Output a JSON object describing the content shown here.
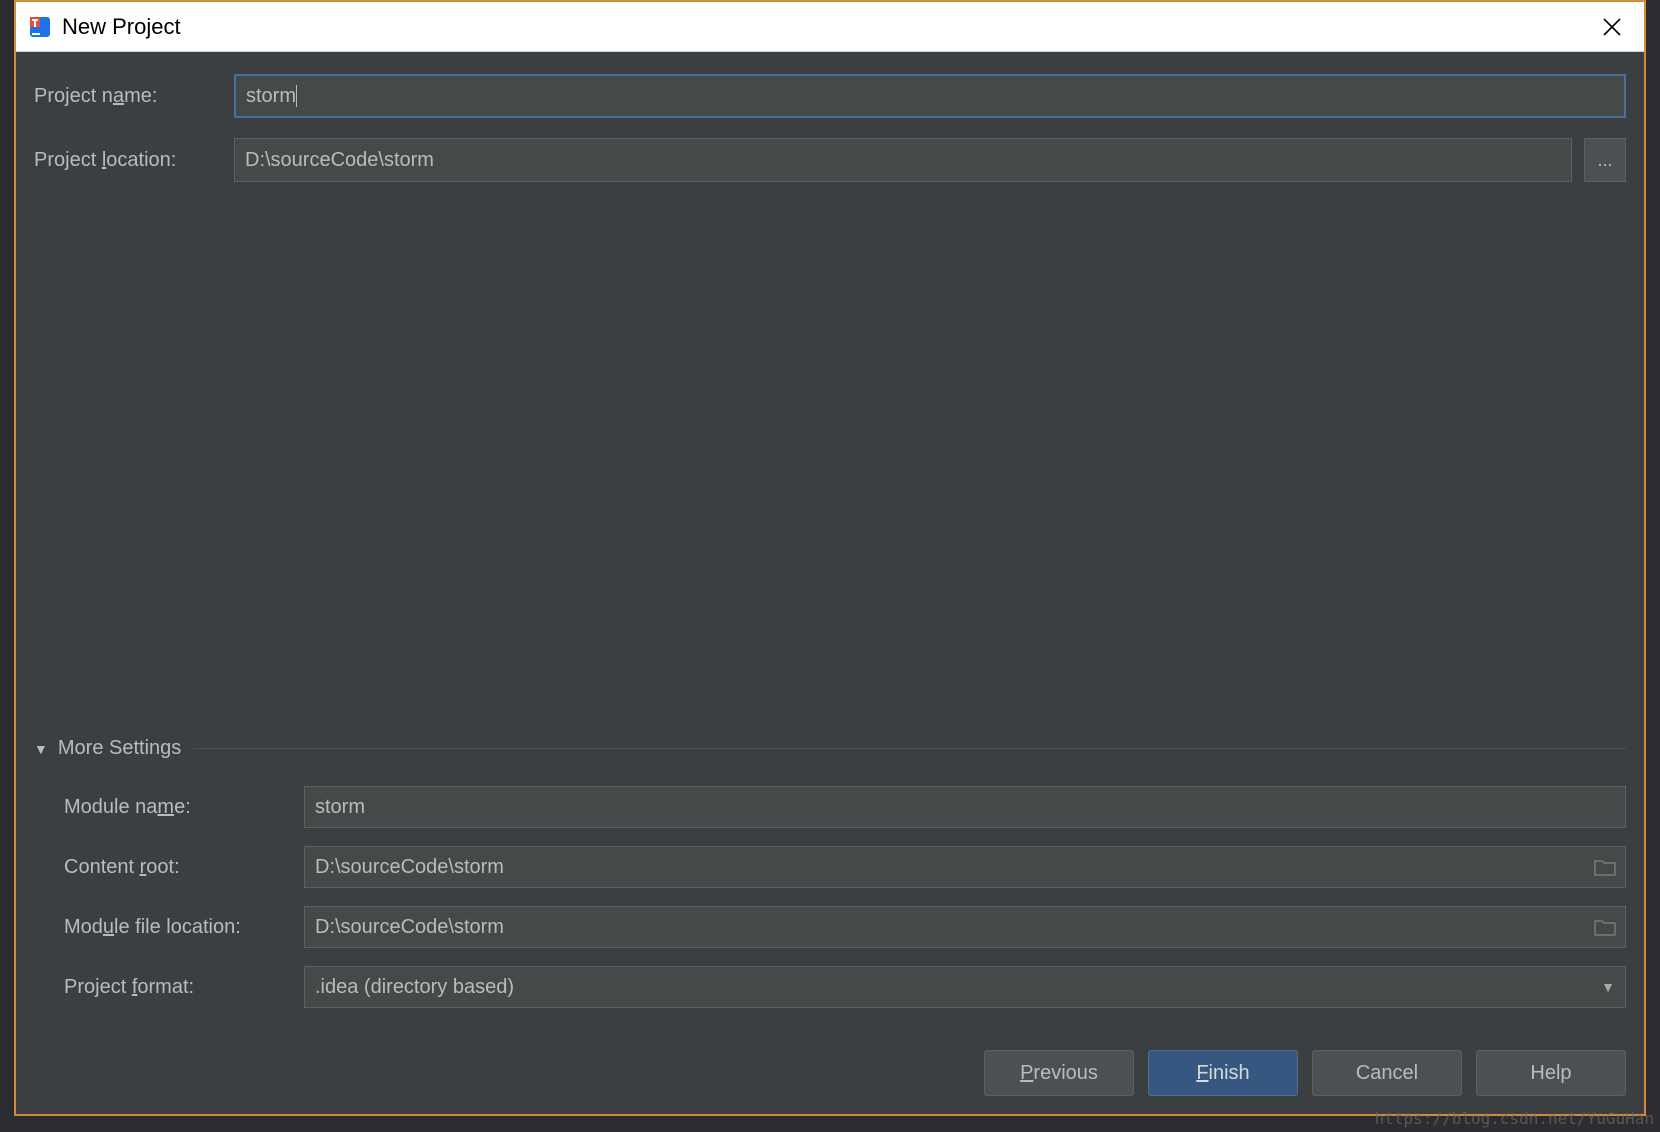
{
  "titlebar": {
    "title": "New Project"
  },
  "form": {
    "project_name_label_pre": "Project n",
    "project_name_label_mn": "a",
    "project_name_label_post": "me:",
    "project_name_value": "storm",
    "project_location_label_pre": "Project ",
    "project_location_label_mn": "l",
    "project_location_label_post": "ocation:",
    "project_location_value": "D:\\sourceCode\\storm",
    "browse_label": "..."
  },
  "more": {
    "header_pre": "Mor",
    "header_mn": "e",
    "header_post": " Settings",
    "module_name_label_pre": "Module na",
    "module_name_label_mn": "m",
    "module_name_label_post": "e:",
    "module_name_value": "storm",
    "content_root_label_pre": "Content ",
    "content_root_label_mn": "r",
    "content_root_label_post": "oot:",
    "content_root_value": "D:\\sourceCode\\storm",
    "module_file_loc_label_pre": "Mod",
    "module_file_loc_label_mn": "u",
    "module_file_loc_label_post": "le file location:",
    "module_file_loc_value": "D:\\sourceCode\\storm",
    "project_format_label_pre": "Project ",
    "project_format_label_mn": "f",
    "project_format_label_post": "ormat:",
    "project_format_value": ".idea (directory based)"
  },
  "buttons": {
    "previous_mn": "P",
    "previous_post": "revious",
    "finish_mn": "F",
    "finish_post": "inish",
    "cancel": "Cancel",
    "help": "Help"
  },
  "watermark": "https://blog.csdn.net/YuGuHan"
}
